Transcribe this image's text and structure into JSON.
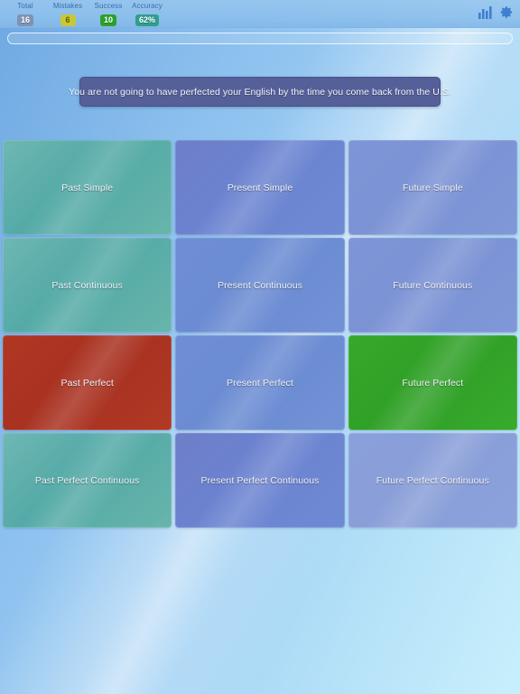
{
  "header": {
    "stats": [
      {
        "name": "total",
        "label": "Total",
        "value": "16"
      },
      {
        "name": "mistakes",
        "label": "Mistakes",
        "value": "6"
      },
      {
        "name": "success",
        "label": "Success",
        "value": "10"
      },
      {
        "name": "accuracy",
        "label": "Accuracy",
        "value": "62%"
      }
    ],
    "icons": [
      {
        "name": "statistics-icon",
        "glyph": "bar-chart"
      },
      {
        "name": "settings-icon",
        "glyph": "gear"
      }
    ],
    "colors": {
      "total_badge": "#7e93b4",
      "mistakes_badge": "#c7c834",
      "success_badge": "#2aa12a",
      "accuracy_badge": "#2e9e8e",
      "label_text": "#3a6ea8"
    }
  },
  "progress": {
    "percent": 0,
    "label": ""
  },
  "question": {
    "sentence": "You are not going to have perfected your English by the time you come back from the U.S."
  },
  "grid": {
    "tiles": [
      {
        "label": "Past Simple",
        "state": "neutral",
        "style": "tile-teal"
      },
      {
        "label": "Present Simple",
        "state": "neutral",
        "style": "tile-violet"
      },
      {
        "label": "Future Simple",
        "state": "neutral",
        "style": "tile-blue"
      },
      {
        "label": "Past Continuous",
        "state": "neutral",
        "style": "tile-teal"
      },
      {
        "label": "Present Continuous",
        "state": "neutral",
        "style": "tile-blue-mid"
      },
      {
        "label": "Future Continuous",
        "state": "neutral",
        "style": "tile-blue"
      },
      {
        "label": "Past Perfect",
        "state": "wrong",
        "style": "tile-wrong"
      },
      {
        "label": "Present Perfect",
        "state": "neutral",
        "style": "tile-blue-mid"
      },
      {
        "label": "Future Perfect",
        "state": "correct",
        "style": "tile-correct"
      },
      {
        "label": "Past Perfect Continuous",
        "state": "neutral",
        "style": "tile-teal"
      },
      {
        "label": "Present Perfect Continuous",
        "state": "neutral",
        "style": "tile-violet"
      },
      {
        "label": "Future Perfect Continuous",
        "state": "neutral",
        "style": "tile-blue-light"
      }
    ],
    "colors": {
      "wrong": "#ad3322",
      "correct": "#35a52a"
    }
  }
}
